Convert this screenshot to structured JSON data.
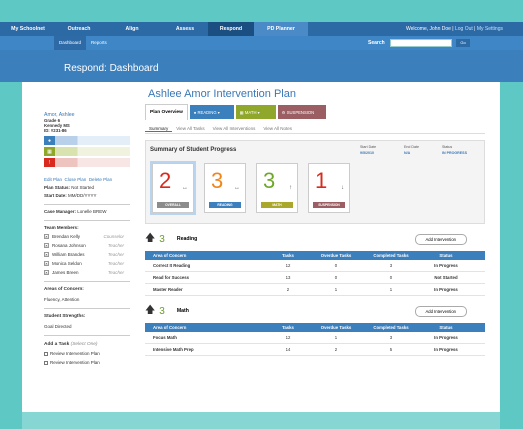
{
  "nav": {
    "items": [
      "My Schoolnet",
      "Outreach",
      "Align",
      "Assess",
      "Respond",
      "PD Planner"
    ],
    "active": 4,
    "welcome": "Welcome, John Doe",
    "logout": "Log Out",
    "settings": "My Settings"
  },
  "subnav": {
    "items": [
      "Dashboard",
      "Reports"
    ],
    "search_label": "Search",
    "go": "Go"
  },
  "banner": {
    "title": "Respond: Dashboard"
  },
  "plan_title": "Ashlee Amor Intervention Plan",
  "student": {
    "name": "Amor, Ashlee",
    "grade": "Grade 6",
    "school": "Kennedy MS",
    "id": "ID: #231-86",
    "links": [
      "Edit Plan",
      "Close Plan",
      "Delete Plan"
    ],
    "plan_status_label": "Plan Status:",
    "plan_status": "Not Started",
    "start_label": "Start Date:",
    "start": "MM/DD/YYYY",
    "case_label": "Case Manager:",
    "case": "Lonelle BREW",
    "team_label": "Team Members:",
    "team": [
      {
        "name": "Brendan Kelly",
        "role": "Counselor"
      },
      {
        "name": "Rosana Johnson",
        "role": "Teacher"
      },
      {
        "name": "William Brandes",
        "role": "Teacher"
      },
      {
        "name": "Monica Seldon",
        "role": "Teacher"
      },
      {
        "name": "James Breen",
        "role": "Teacher"
      }
    ],
    "concerns_label": "Areas of Concern:",
    "concerns": "Fluency, Attention",
    "strengths_label": "Student Strengths:",
    "strengths": "Goal Directed",
    "task_label": "Add a Task",
    "task_hint": "(Select One)",
    "task_opts": [
      "Review Intervention Plan",
      "Review Intervention Plan"
    ]
  },
  "tabs": {
    "overview": "Plan Overview",
    "cats": [
      {
        "label": "READING",
        "color": "#3c7fbd"
      },
      {
        "label": "MATH",
        "color": "#8fa82b"
      },
      {
        "label": "SUSPENSION",
        "color": "#9b5f63"
      }
    ]
  },
  "subtabs": [
    "Summary",
    "View All Tasks",
    "View All Interventions",
    "View All Notes"
  ],
  "summary": {
    "title": "Summary of Student Progress",
    "start_label": "Start Date",
    "start": "9/5/2010",
    "end_label": "End Date",
    "end": "N/A",
    "status_label": "Status",
    "status": "IN PROGRESS",
    "cards": [
      {
        "num": "2",
        "label": "OVERALL",
        "color": "#d82a1e",
        "bar": "#8c8c8c",
        "arrow": "↔"
      },
      {
        "num": "3",
        "label": "READING",
        "color": "#f0851e",
        "bar": "#3c7fbd",
        "arrow": "↔"
      },
      {
        "num": "3",
        "label": "MATH",
        "color": "#6ea82b",
        "bar": "#a9a82a",
        "arrow": "↑"
      },
      {
        "num": "1",
        "label": "SUSPENSION",
        "color": "#d82a1e",
        "bar": "#9b5f63",
        "arrow": "↓"
      }
    ]
  },
  "headers": [
    "Area of Concern",
    "Tasks",
    "Overdue Tasks",
    "Completed Tasks",
    "Status"
  ],
  "reading": {
    "score": "3",
    "title": "Reading",
    "add": "Add Intervention",
    "rows": [
      [
        "Correct It Reading",
        "12",
        "0",
        "3",
        "In Progress"
      ],
      [
        "Read for Success",
        "13",
        "0",
        "0",
        "Not Started"
      ],
      [
        "Master Reader",
        "2",
        "1",
        "1",
        "In Progress"
      ]
    ]
  },
  "math": {
    "score": "3",
    "title": "Math",
    "add": "Add Intervention",
    "rows": [
      [
        "Focus Math",
        "12",
        "1",
        "3",
        "In Progress"
      ],
      [
        "Intensive Math Prep",
        "14",
        "2",
        "5",
        "In Progress"
      ]
    ]
  }
}
